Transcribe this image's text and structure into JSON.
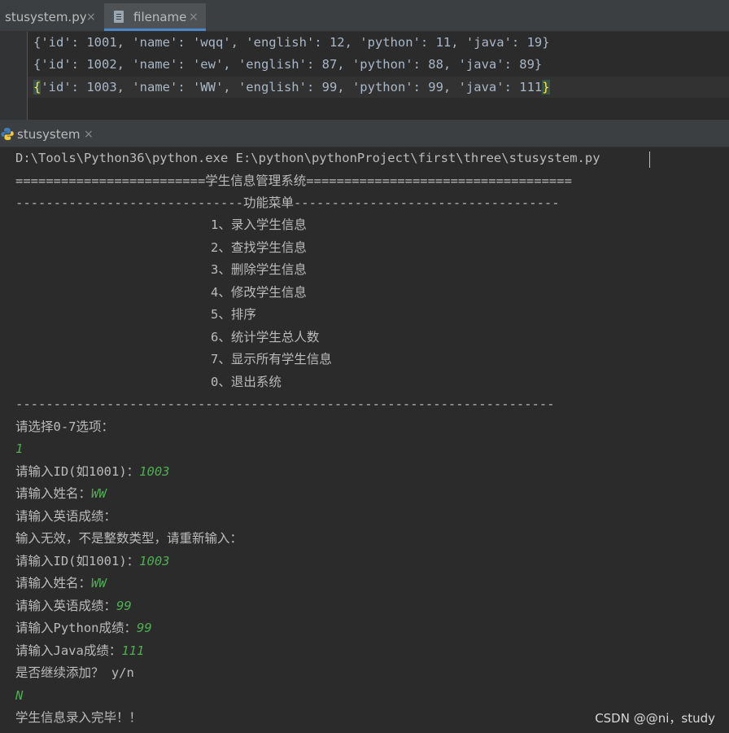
{
  "tabs": [
    {
      "label": "stusystem.py",
      "close": "×"
    },
    {
      "label": "filename",
      "close": "×"
    }
  ],
  "editor_lines": [
    "{'id': 1001, 'name': 'wqq', 'english': 12, 'python': 11, 'java': 19}",
    "{'id': 1002, 'name': 'ew', 'english': 87, 'python': 88, 'java': 89}",
    {
      "open": "{",
      "body": "'id': 1003, 'name': 'WW', 'english': 99, 'python': 99, 'java': 111",
      "close": "}"
    }
  ],
  "run_tab": {
    "label": "stusystem",
    "close": "×"
  },
  "console": {
    "command": "D:\\Tools\\Python36\\python.exe E:\\python\\pythonProject\\first\\three\\stusystem.py",
    "title_line": "=========================学生信息管理系统===================================",
    "menu_header": "------------------------------功能菜单-----------------------------------",
    "menu_items": [
      "1、录入学生信息",
      "2、查找学生信息",
      "3、删除学生信息",
      "4、修改学生信息",
      "5、排序",
      "6、统计学生总人数",
      "7、显示所有学生信息",
      "0、退出系统"
    ],
    "menu_footer": "-----------------------------------------------------------------------",
    "dialog": [
      {
        "prompt": "请选择0-7选项：",
        "input": ""
      },
      {
        "prompt": "",
        "input": "1"
      },
      {
        "prompt": "请输入ID(如1001)：",
        "input": "1003"
      },
      {
        "prompt": "请输入姓名：",
        "input": "WW"
      },
      {
        "prompt": "请输入英语成绩：",
        "input": ""
      },
      {
        "prompt": "输入无效，不是整数类型，请重新输入：",
        "input": ""
      },
      {
        "prompt": "请输入ID(如1001)：",
        "input": "1003"
      },
      {
        "prompt": "请输入姓名：",
        "input": "WW"
      },
      {
        "prompt": "请输入英语成绩：",
        "input": "99"
      },
      {
        "prompt": "请输入Python成绩：",
        "input": "99"
      },
      {
        "prompt": "请输入Java成绩：",
        "input": "111"
      },
      {
        "prompt": "是否继续添加？ y/n",
        "input": ""
      },
      {
        "prompt": "",
        "input": "N"
      },
      {
        "prompt": "学生信息录入完毕！！",
        "input": ""
      }
    ]
  },
  "watermark": "CSDN @@ni，study",
  "colors": {
    "input_green": "#4caf50",
    "brace_yellow": "#ffef28",
    "background": "#2b2b2b"
  }
}
